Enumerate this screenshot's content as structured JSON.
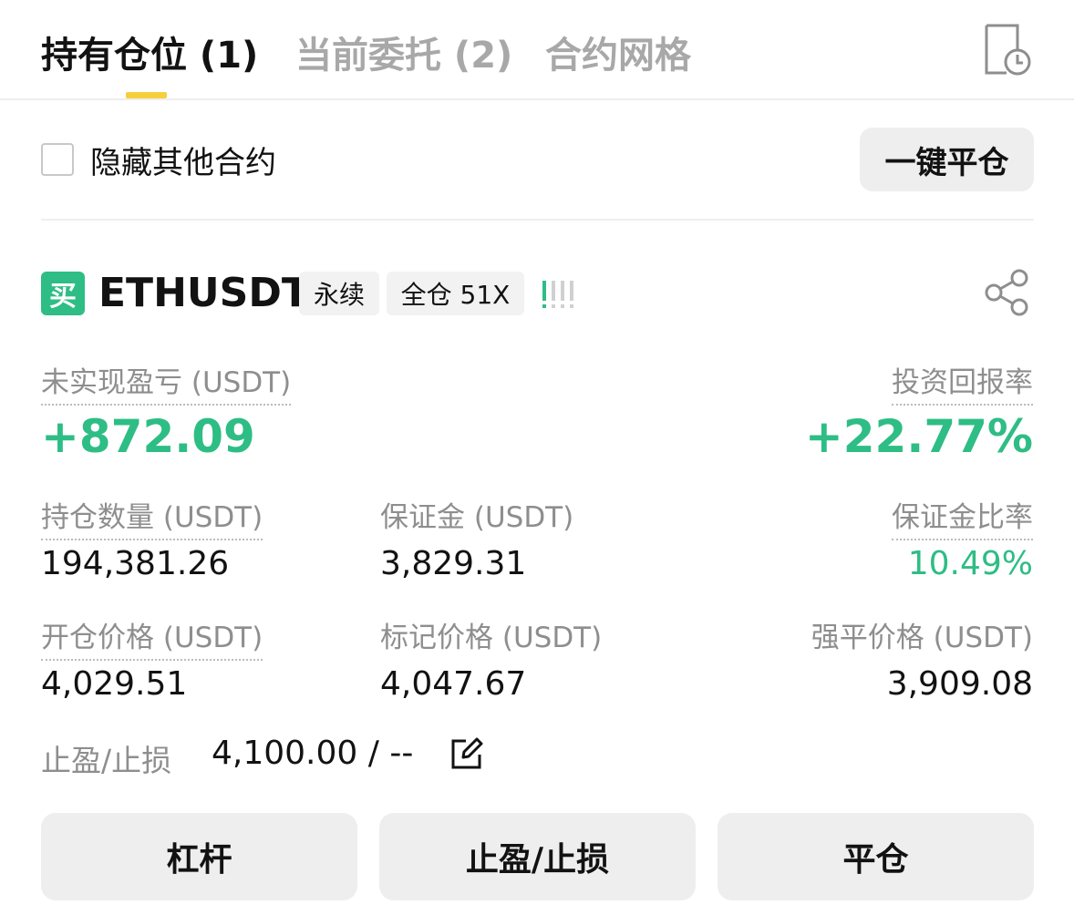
{
  "tabs": [
    {
      "label": "持有仓位 (1)",
      "active": true
    },
    {
      "label": "当前委托 (2)",
      "active": false
    },
    {
      "label": "合约网格",
      "active": false
    }
  ],
  "header": {
    "history_icon": "order-history-clock-icon"
  },
  "filter": {
    "hide_other_label": "隐藏其他合约",
    "checked": false,
    "close_all_label": "一键平仓"
  },
  "position": {
    "side_badge": "买",
    "symbol": "ETHUSDT",
    "contract_type": "永续",
    "margin_mode": "全仓 51X",
    "adl_icon": "adl-indicator-icon",
    "share_icon": "share-icon",
    "unrealized_pnl_label": "未实现盈亏 (USDT)",
    "unrealized_pnl": "+872.09",
    "roi_label": "投资回报率",
    "roi": "+22.77%",
    "size_label": "持仓数量 (USDT)",
    "size": "194,381.26",
    "margin_label": "保证金 (USDT)",
    "margin": "3,829.31",
    "margin_ratio_label": "保证金比率",
    "margin_ratio": "10.49%",
    "entry_price_label": "开仓价格 (USDT)",
    "entry_price": "4,029.51",
    "mark_price_label": "标记价格 (USDT)",
    "mark_price": "4,047.67",
    "liq_price_label": "强平价格 (USDT)",
    "liq_price": "3,909.08",
    "tpsl_label": "止盈/止损",
    "tpsl_value": "4,100.00 / --",
    "edit_icon": "edit-icon"
  },
  "actions": {
    "leverage": "杠杆",
    "tpsl": "止盈/止损",
    "close": "平仓"
  },
  "colors": {
    "up_green": "#2ebd85",
    "accent_yellow": "#f6cf3c",
    "muted": "#8e8e8e"
  }
}
